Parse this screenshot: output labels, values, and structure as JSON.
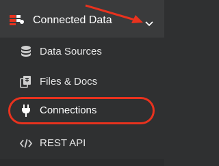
{
  "header": {
    "label": "Connected Data",
    "icon": "connected-data-icon",
    "chevron": "chevron-down-icon"
  },
  "menu": {
    "items": [
      {
        "label": "Data Sources",
        "icon": "database-icon"
      },
      {
        "label": "Files & Docs",
        "icon": "files-icon"
      },
      {
        "label": "Connections",
        "icon": "plug-icon",
        "highlighted": true
      },
      {
        "label": "REST API",
        "icon": "code-icon"
      }
    ]
  },
  "colors": {
    "background": "#2f3031",
    "header_background": "#3a3b3c",
    "highlight": "#e8321e",
    "accent_red": "#e8321e",
    "text": "#e6e6e6"
  }
}
